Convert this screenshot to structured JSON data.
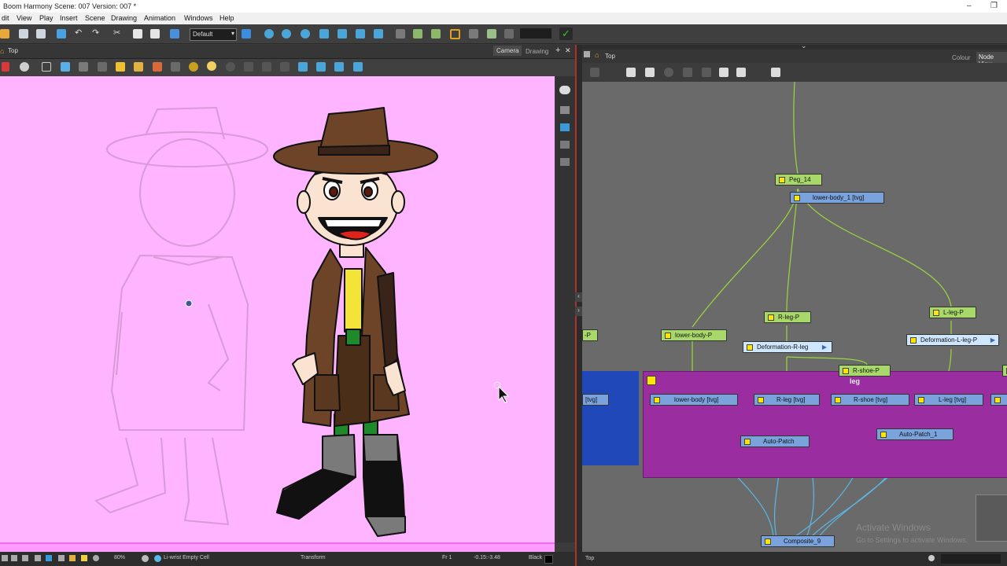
{
  "window": {
    "title": "Boom Harmony Scene: 007 Version: 007 *",
    "minimize": "–",
    "restore": "❐"
  },
  "menu": [
    "dit",
    "View",
    "Play",
    "Insert",
    "Scene",
    "Drawing",
    "Animation",
    "Windows",
    "Help"
  ],
  "toolbar": {
    "combo_value": "Default"
  },
  "camera_view": {
    "header_title": "Top",
    "tabs": [
      "Camera",
      "Drawing"
    ],
    "add_tab": "+",
    "close_tab": "✕"
  },
  "left_status": {
    "zoom": "80%",
    "mode": "Li-wrist Empty Cell",
    "tool": "Transform",
    "frame": "Fr 1",
    "coords": "-0.15:-3.48",
    "color": "Black"
  },
  "node_view": {
    "header_title": "Top",
    "tabs": [
      "Colour",
      "Node View"
    ],
    "group_label": "leg",
    "nodes": {
      "peg14": "Peg_14",
      "lowerbody1": "lower-body_1  [tvg]",
      "rlegp": "R-leg-P",
      "llegp": "L-leg-P",
      "lowerbodyp": "lower-body-P",
      "leftp": "-P",
      "defrleg": "Deformation-R-leg",
      "deflleg": "Deformation-L-leg-P",
      "rshoep": "R-shoe-P",
      "tvgleft": "[tvg]",
      "lowerbody": "lower-body  [tvg]",
      "rleg": "R-leg  [tvg]",
      "rshoe": "R-shoe  [tvg]",
      "lleg": "L-leg  [tvg]",
      "autopatch": "Auto-Patch",
      "autopatch1": "Auto-Patch_1",
      "composite": "Composite_9"
    }
  },
  "right_status": {
    "view": "Top"
  },
  "watermark": {
    "line1": "Activate Windows",
    "line2": "Go to Settings to activate Windows."
  }
}
